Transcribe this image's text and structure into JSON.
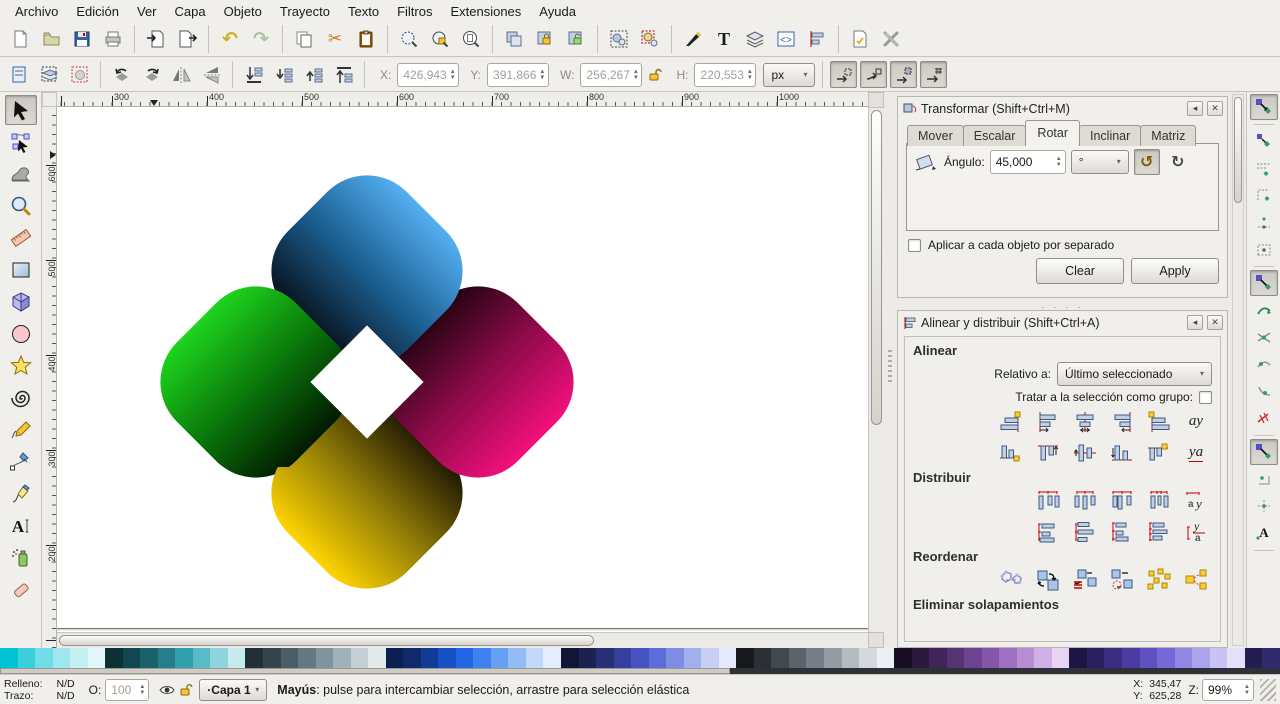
{
  "menu": {
    "items": [
      "Archivo",
      "Edición",
      "Ver",
      "Capa",
      "Objeto",
      "Trayecto",
      "Texto",
      "Filtros",
      "Extensiones",
      "Ayuda"
    ]
  },
  "glyphs": {
    "undo": "↶",
    "redo": "↷",
    "cut": "✂",
    "text_tool": "T",
    "chevron": "▾",
    "spin_up": "▲",
    "spin_down": "▼",
    "rotate_ccw": "↺",
    "rotate_cw": "↻",
    "dock_handle": "· · · ·",
    "shade_left": "◂",
    "close": "✕"
  },
  "tool_controls": {
    "x_label": "X:",
    "x_value": "426,943",
    "y_label": "Y:",
    "y_value": "391,866",
    "w_label": "W:",
    "w_value": "256,267",
    "h_label": "H:",
    "h_value": "220,553",
    "unit_value": "px"
  },
  "rulers": {
    "h_labels": [
      "300",
      "400",
      "500",
      "600",
      "700",
      "800",
      "900",
      "1000"
    ],
    "v_labels": [
      "600",
      "500",
      "400",
      "300",
      "200"
    ]
  },
  "transform_dialog": {
    "title": "Transformar (Shift+Ctrl+M)",
    "tabs": [
      "Mover",
      "Escalar",
      "Rotar",
      "Inclinar",
      "Matriz"
    ],
    "angle_label": "Ángulo:",
    "angle_value": "45,000",
    "unit_value": "°",
    "apply_separately_label": "Aplicar a cada objeto por separado",
    "clear_button": "Clear",
    "apply_button": "Apply"
  },
  "align_dialog": {
    "title": "Alinear y distribuir (Shift+Ctrl+A)",
    "align_header": "Alinear",
    "relative_label": "Relativo a:",
    "relative_value": "Último seleccionado",
    "treat_as_group_label": "Tratar a la selección como grupo:",
    "distribute_header": "Distribuir",
    "reorder_header": "Reordenar",
    "remove_overlaps_header": "Eliminar solapamientos",
    "text_icon_xy": "ay",
    "text_icon_yx": "ya"
  },
  "status_bar": {
    "fill_label": "Relleno:",
    "fill_value": "N/D",
    "stroke_label": "Trazo:",
    "stroke_value": "N/D",
    "opacity_label": "O:",
    "opacity_value": "100",
    "layer_value": "·Capa 1",
    "message_bold": "Mayús",
    "message_rest": ": pulse para intercambiar selección, arrastre para selección elástica",
    "x_label": "X:",
    "x_value": "345,47",
    "y_label": "Y:",
    "y_value": "625,28",
    "zoom_label": "Z:",
    "zoom_value": "99%"
  },
  "logo": {
    "blue_bright": "#54b0f2",
    "blue_dark": "#060e18",
    "pink_bright": "#f2107c",
    "pink_dark": "#1d030f",
    "yellow_bright": "#ffd300",
    "yellow_dark": "#181202",
    "green_bright": "#1ed41e",
    "green_dark": "#021a02"
  },
  "palette": {
    "colors": [
      "#00c3d4",
      "#39cfdd",
      "#6fdce7",
      "#9fe7ee",
      "#c4f0f4",
      "#e2f7fa",
      "#0c3034",
      "#124750",
      "#1a616b",
      "#247e8b",
      "#31a0ae",
      "#57bcc8",
      "#8fd4dc",
      "#c6ebef",
      "#223036",
      "#35454d",
      "#4b5d66",
      "#637881",
      "#7f949d",
      "#9fb2b9",
      "#c2d0d5",
      "#e2eaec",
      "#0b1f52",
      "#0e2a6d",
      "#123b96",
      "#1750c2",
      "#2366e6",
      "#3d82f0",
      "#66a1f4",
      "#94bdf8",
      "#c2d9fb",
      "#e3eefd",
      "#121738",
      "#1b2252",
      "#273077",
      "#35409c",
      "#4653c0",
      "#5c6cd8",
      "#7e8ce4",
      "#a2afee",
      "#c8cff5",
      "#e6e9fb",
      "#16181c",
      "#2b3036",
      "#42484f",
      "#5b636b",
      "#757e86",
      "#949ca4",
      "#b4bbc1",
      "#d4d9dd",
      "#edf0f2",
      "#190e24",
      "#2c193e",
      "#402558",
      "#563373",
      "#6d4390",
      "#8656ab",
      "#9e6fc2",
      "#b78dd5",
      "#cfb0e5",
      "#e6d4f2",
      "#1d1542",
      "#2a1f60",
      "#3a2c80",
      "#4c3ba2",
      "#6050c2",
      "#7668d6",
      "#9186e2",
      "#aca3ec",
      "#c9c2f4",
      "#e5e1fa",
      "#241d52",
      "#322a6e"
    ]
  }
}
